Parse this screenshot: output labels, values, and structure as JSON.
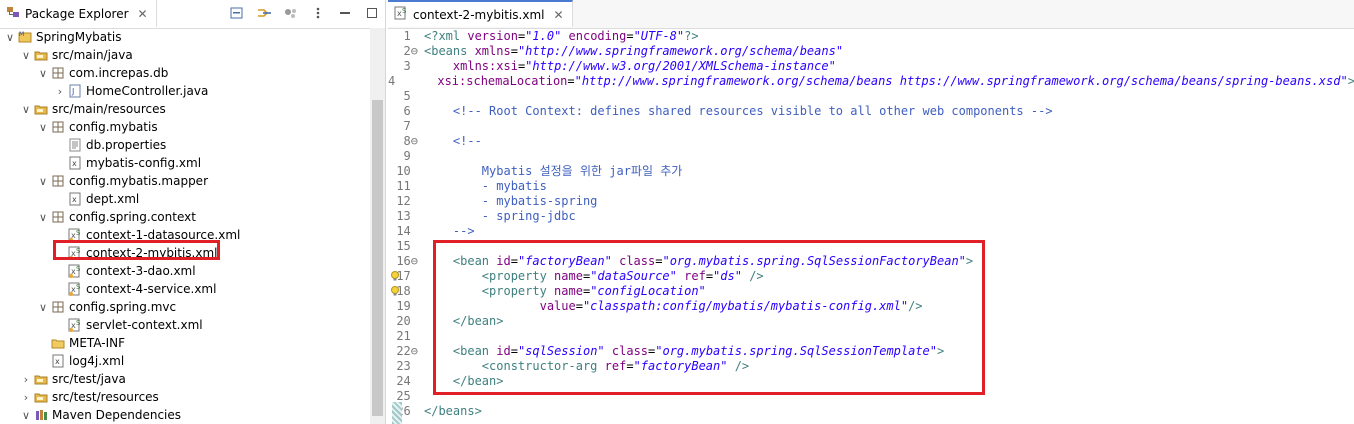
{
  "explorer": {
    "title": "Package Explorer",
    "items": [
      {
        "label": "SpringMybatis",
        "depth": 0,
        "chev": "∨",
        "icon": "project-icon",
        "sel": false
      },
      {
        "label": "src/main/java",
        "depth": 1,
        "chev": "∨",
        "icon": "source-folder-icon",
        "sel": false
      },
      {
        "label": "com.increpas.db",
        "depth": 2,
        "chev": "∨",
        "icon": "package-icon",
        "sel": false
      },
      {
        "label": "HomeController.java",
        "depth": 3,
        "chev": "›",
        "icon": "java-file-icon",
        "sel": false
      },
      {
        "label": "src/main/resources",
        "depth": 1,
        "chev": "∨",
        "icon": "source-folder-icon",
        "sel": false
      },
      {
        "label": "config.mybatis",
        "depth": 2,
        "chev": "∨",
        "icon": "package-icon",
        "sel": false
      },
      {
        "label": "db.properties",
        "depth": 3,
        "chev": "",
        "icon": "properties-file-icon",
        "sel": false
      },
      {
        "label": "mybatis-config.xml",
        "depth": 3,
        "chev": "",
        "icon": "xml-file-icon",
        "sel": false
      },
      {
        "label": "config.mybatis.mapper",
        "depth": 2,
        "chev": "∨",
        "icon": "package-icon",
        "sel": false
      },
      {
        "label": "dept.xml",
        "depth": 3,
        "chev": "",
        "icon": "xml-file-icon",
        "sel": false
      },
      {
        "label": "config.spring.context",
        "depth": 2,
        "chev": "∨",
        "icon": "package-icon",
        "sel": false
      },
      {
        "label": "context-1-datasource.xml",
        "depth": 3,
        "chev": "",
        "icon": "spring-xml-icon",
        "sel": false
      },
      {
        "label": "context-2-mybitis.xml",
        "depth": 3,
        "chev": "",
        "icon": "spring-xml-icon",
        "sel": true
      },
      {
        "label": "context-3-dao.xml",
        "depth": 3,
        "chev": "",
        "icon": "spring-xml-icon",
        "sel": false
      },
      {
        "label": "context-4-service.xml",
        "depth": 3,
        "chev": "",
        "icon": "spring-xml-icon",
        "sel": false
      },
      {
        "label": "config.spring.mvc",
        "depth": 2,
        "chev": "∨",
        "icon": "package-icon",
        "sel": false
      },
      {
        "label": "servlet-context.xml",
        "depth": 3,
        "chev": "",
        "icon": "spring-xml-icon",
        "sel": false
      },
      {
        "label": "META-INF",
        "depth": 2,
        "chev": "",
        "icon": "folder-icon",
        "sel": false
      },
      {
        "label": "log4j.xml",
        "depth": 2,
        "chev": "",
        "icon": "xml-file-icon",
        "sel": false
      },
      {
        "label": "src/test/java",
        "depth": 1,
        "chev": "›",
        "icon": "source-folder-icon",
        "sel": false
      },
      {
        "label": "src/test/resources",
        "depth": 1,
        "chev": "›",
        "icon": "source-folder-icon",
        "sel": false
      },
      {
        "label": "Maven Dependencies",
        "depth": 1,
        "chev": "∨",
        "icon": "library-icon",
        "sel": false
      }
    ]
  },
  "editor": {
    "tab_title": "context-2-mybitis.xml",
    "lines": [
      {
        "n": "1",
        "fold": "",
        "mark": "",
        "segs": [
          [
            "tag",
            "<?xml "
          ],
          [
            "att",
            "version"
          ],
          [
            "plain",
            "="
          ],
          [
            "val",
            "\"1.0\""
          ],
          [
            "plain",
            " "
          ],
          [
            "att",
            "encoding"
          ],
          [
            "plain",
            "="
          ],
          [
            "val",
            "\"UTF-8\""
          ],
          [
            "tag",
            "?>"
          ]
        ]
      },
      {
        "n": "2",
        "fold": "⊖",
        "mark": "",
        "segs": [
          [
            "tag",
            "<beans "
          ],
          [
            "att",
            "xmlns"
          ],
          [
            "plain",
            "="
          ],
          [
            "val",
            "\"http://www.springframework.org/schema/beans\""
          ]
        ]
      },
      {
        "n": "3",
        "fold": "",
        "mark": "",
        "segs": [
          [
            "plain",
            "    "
          ],
          [
            "att",
            "xmlns:xsi"
          ],
          [
            "plain",
            "="
          ],
          [
            "val",
            "\"http://www.w3.org/2001/XMLSchema-instance\""
          ]
        ]
      },
      {
        "n": "4",
        "fold": "",
        "mark": "",
        "segs": [
          [
            "plain",
            "    "
          ],
          [
            "att",
            "xsi:schemaLocation"
          ],
          [
            "plain",
            "="
          ],
          [
            "val",
            "\"http://www.springframework.org/schema/beans https://www.springframework.org/schema/beans/spring-beans.xsd\""
          ],
          [
            "tag",
            ">"
          ]
        ]
      },
      {
        "n": "5",
        "fold": "",
        "mark": "",
        "segs": [
          [
            "plain",
            ""
          ]
        ]
      },
      {
        "n": "6",
        "fold": "",
        "mark": "",
        "segs": [
          [
            "plain",
            "    "
          ],
          [
            "com",
            "<!-- Root Context: defines shared resources visible to all other web components -->"
          ]
        ]
      },
      {
        "n": "7",
        "fold": "",
        "mark": "",
        "segs": [
          [
            "plain",
            ""
          ]
        ]
      },
      {
        "n": "8",
        "fold": "⊖",
        "mark": "",
        "segs": [
          [
            "plain",
            "    "
          ],
          [
            "com",
            "<!--"
          ]
        ]
      },
      {
        "n": "9",
        "fold": "",
        "mark": "",
        "segs": [
          [
            "plain",
            ""
          ]
        ]
      },
      {
        "n": "10",
        "fold": "",
        "mark": "",
        "segs": [
          [
            "plain",
            "        "
          ],
          [
            "com",
            "Mybatis 설정을 위한 jar파일 추가"
          ]
        ]
      },
      {
        "n": "11",
        "fold": "",
        "mark": "",
        "segs": [
          [
            "plain",
            "        "
          ],
          [
            "com",
            "- mybatis"
          ]
        ]
      },
      {
        "n": "12",
        "fold": "",
        "mark": "",
        "segs": [
          [
            "plain",
            "        "
          ],
          [
            "com",
            "- mybatis-spring"
          ]
        ]
      },
      {
        "n": "13",
        "fold": "",
        "mark": "",
        "segs": [
          [
            "plain",
            "        "
          ],
          [
            "com",
            "- spring-jdbc"
          ]
        ]
      },
      {
        "n": "14",
        "fold": "",
        "mark": "",
        "segs": [
          [
            "plain",
            "    "
          ],
          [
            "com",
            "-->"
          ]
        ]
      },
      {
        "n": "15",
        "fold": "",
        "mark": "",
        "segs": [
          [
            "plain",
            ""
          ]
        ]
      },
      {
        "n": "16",
        "fold": "⊖",
        "mark": "",
        "segs": [
          [
            "plain",
            "    "
          ],
          [
            "tag",
            "<bean "
          ],
          [
            "att",
            "id"
          ],
          [
            "plain",
            "="
          ],
          [
            "val",
            "\"factoryBean\""
          ],
          [
            "plain",
            " "
          ],
          [
            "att",
            "class"
          ],
          [
            "plain",
            "="
          ],
          [
            "val",
            "\"org.mybatis.spring.SqlSessionFactoryBean\""
          ],
          [
            "tag",
            ">"
          ]
        ]
      },
      {
        "n": "17",
        "fold": "",
        "mark": "bulb",
        "segs": [
          [
            "plain",
            "        "
          ],
          [
            "tag",
            "<property "
          ],
          [
            "att",
            "name"
          ],
          [
            "plain",
            "="
          ],
          [
            "val",
            "\"dataSource\""
          ],
          [
            "plain",
            " "
          ],
          [
            "att",
            "ref"
          ],
          [
            "plain",
            "="
          ],
          [
            "val",
            "\"ds\""
          ],
          [
            "plain",
            " "
          ],
          [
            "tag",
            "/>"
          ]
        ]
      },
      {
        "n": "18",
        "fold": "",
        "mark": "bulb",
        "segs": [
          [
            "plain",
            "        "
          ],
          [
            "tag",
            "<property "
          ],
          [
            "att",
            "name"
          ],
          [
            "plain",
            "="
          ],
          [
            "val",
            "\"configLocation\""
          ]
        ]
      },
      {
        "n": "19",
        "fold": "",
        "mark": "",
        "segs": [
          [
            "plain",
            "                "
          ],
          [
            "att",
            "value"
          ],
          [
            "plain",
            "="
          ],
          [
            "val",
            "\"classpath:config/mybatis/mybatis-config.xml\""
          ],
          [
            "tag",
            "/>"
          ]
        ]
      },
      {
        "n": "20",
        "fold": "",
        "mark": "",
        "segs": [
          [
            "plain",
            "    "
          ],
          [
            "tag",
            "</bean>"
          ]
        ]
      },
      {
        "n": "21",
        "fold": "",
        "mark": "",
        "segs": [
          [
            "plain",
            ""
          ]
        ]
      },
      {
        "n": "22",
        "fold": "⊖",
        "mark": "",
        "segs": [
          [
            "plain",
            "    "
          ],
          [
            "tag",
            "<bean "
          ],
          [
            "att",
            "id"
          ],
          [
            "plain",
            "="
          ],
          [
            "val",
            "\"sqlSession\""
          ],
          [
            "plain",
            " "
          ],
          [
            "att",
            "class"
          ],
          [
            "plain",
            "="
          ],
          [
            "val",
            "\"org.mybatis.spring.SqlSessionTemplate\""
          ],
          [
            "tag",
            ">"
          ]
        ]
      },
      {
        "n": "23",
        "fold": "",
        "mark": "",
        "segs": [
          [
            "plain",
            "        "
          ],
          [
            "tag",
            "<constructor-arg "
          ],
          [
            "att",
            "ref"
          ],
          [
            "plain",
            "="
          ],
          [
            "val",
            "\"factoryBean\""
          ],
          [
            "plain",
            " "
          ],
          [
            "tag",
            "/>"
          ]
        ]
      },
      {
        "n": "24",
        "fold": "",
        "mark": "",
        "segs": [
          [
            "plain",
            "    "
          ],
          [
            "tag",
            "</bean>"
          ]
        ]
      },
      {
        "n": "25",
        "fold": "",
        "mark": "",
        "segs": [
          [
            "plain",
            ""
          ]
        ]
      },
      {
        "n": "26",
        "fold": "",
        "mark": "",
        "segs": [
          [
            "tag",
            "</beans>"
          ]
        ]
      }
    ]
  },
  "colors": {
    "highlight": "#e01f26",
    "tag": "#3f7f7f",
    "attr": "#7f007f",
    "value": "#2a00ff",
    "comment": "#3f5fbf"
  }
}
